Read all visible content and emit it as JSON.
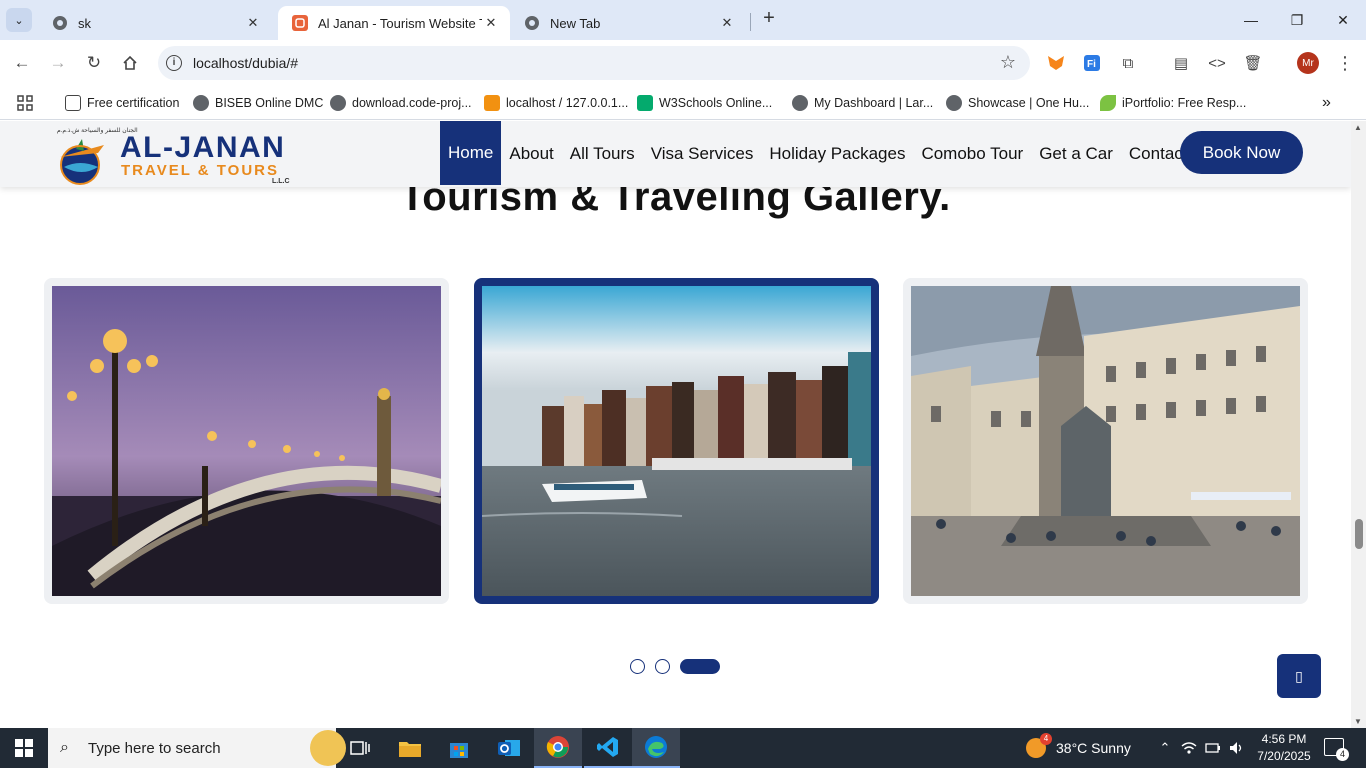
{
  "browser": {
    "tabs": [
      {
        "title": "sk"
      },
      {
        "title": "Al Janan - Tourism Website Tem"
      },
      {
        "title": "New Tab"
      }
    ],
    "url": "localhost/dubia/#",
    "bookmarks": [
      {
        "label": "Free certification"
      },
      {
        "label": "BISEB Online DMC"
      },
      {
        "label": "download.code-proj..."
      },
      {
        "label": "localhost / 127.0.0.1..."
      },
      {
        "label": "W3Schools Online..."
      },
      {
        "label": "My Dashboard | Lar..."
      },
      {
        "label": "Showcase | One Hu..."
      },
      {
        "label": "iPortfolio: Free Resp..."
      }
    ],
    "profile_initials": "Mr"
  },
  "site": {
    "logo": {
      "arabic_line": "الجنان للسفر والسياحة ش.ذ.م.م",
      "name": "AL-JANAN",
      "tagline": "TRAVEL & TOURS",
      "llc": "L.L.C"
    },
    "nav": [
      {
        "label": "Home",
        "active": true
      },
      {
        "label": "About"
      },
      {
        "label": "All Tours"
      },
      {
        "label": "Visa Services"
      },
      {
        "label": "Holiday Packages"
      },
      {
        "label": "Comobo Tour"
      },
      {
        "label": "Get a Car"
      },
      {
        "label": "Contact"
      }
    ],
    "book_button": "Book Now",
    "gallery_title": "Tourism & Traveling Gallery.",
    "gallery": [
      {
        "scene": "Paris bridge at dusk with ornate lamps",
        "active": false
      },
      {
        "scene": "Amsterdam canal with tour boat",
        "active": true
      },
      {
        "scene": "European square with fountain and cathedral",
        "active": false
      }
    ],
    "carousel_pages": 3,
    "carousel_active_index": 2,
    "accent_color": "#16317a",
    "orange_color": "#e88a1e"
  },
  "taskbar": {
    "search_placeholder": "Type here to search",
    "weather": "38°C  Sunny",
    "weather_badge": "4",
    "time": "4:56 PM",
    "date": "7/20/2025",
    "notification_count": "4"
  }
}
